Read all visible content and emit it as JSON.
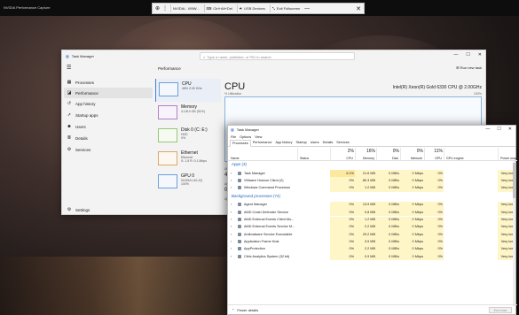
{
  "outer": {
    "title": "NVIDIA Performance Capture"
  },
  "toolbar": {
    "items": [
      "NVIDIA - VMW...",
      "Ctrl+Alt+Del",
      "USB Devices",
      "Exit Fullscreen"
    ]
  },
  "win1": {
    "title": "Task Manager",
    "search_placeholder": "Type a name, publisher, or PID to search",
    "nav": [
      {
        "label": "Processes",
        "icon": "grid-icon"
      },
      {
        "label": "Performance",
        "icon": "chart-icon",
        "active": true
      },
      {
        "label": "App history",
        "icon": "history-icon"
      },
      {
        "label": "Startup apps",
        "icon": "rocket-icon"
      },
      {
        "label": "Users",
        "icon": "users-icon"
      },
      {
        "label": "Details",
        "icon": "list-icon"
      },
      {
        "label": "Services",
        "icon": "services-icon"
      }
    ],
    "settings_label": "Settings",
    "panel_title": "Performance",
    "run_task": "Run new task",
    "resources": [
      {
        "name": "CPU",
        "sub1": "46% 2.00 GHz",
        "sub2": ""
      },
      {
        "name": "Memory",
        "sub1": "4.1/8.0 GB (51%)",
        "sub2": ""
      },
      {
        "name": "Disk 0 (C: E:)",
        "sub1": "HDD",
        "sub2": "0%"
      },
      {
        "name": "Ethernet",
        "sub1": "Ethernet",
        "sub2": "S: 1.5 R: 0.1 Mbps"
      },
      {
        "name": "GPU 0",
        "sub1": "NVIDIA L40-2Q",
        "sub2": "100%"
      }
    ],
    "cpu_title": "CPU",
    "cpu_model": "Intel(R) Xeon(R) Gold 6330 CPU @ 2.00GHz",
    "util_label": "% Utilization",
    "util_max": "100%",
    "stat_frags": [
      "Ut",
      "46",
      "Up",
      "0:0",
      "Up"
    ]
  },
  "win2": {
    "title": "Task Manager",
    "menu": [
      "File",
      "Options",
      "View"
    ],
    "tabs": [
      "Processes",
      "Performance",
      "App history",
      "Startup",
      "Users",
      "Details",
      "Services"
    ],
    "columns": [
      {
        "label": "Name",
        "pct": ""
      },
      {
        "label": "Status",
        "pct": ""
      },
      {
        "label": "CPU",
        "pct": "2%"
      },
      {
        "label": "Memory",
        "pct": "16%"
      },
      {
        "label": "Disk",
        "pct": "0%"
      },
      {
        "label": "Network",
        "pct": "0%"
      },
      {
        "label": "GPU",
        "pct": "11%"
      },
      {
        "label": "GPU engine",
        "pct": ""
      },
      {
        "label": "Power usage",
        "pct": ""
      }
    ],
    "apps_group": "Apps (3)",
    "apps": [
      {
        "name": "Task Manager",
        "cpu": "6.1%",
        "mem": "21.6 MB",
        "disk": "0 MB/s",
        "net": "0 Mbps",
        "gpu": "0%",
        "power": "Very low"
      },
      {
        "name": "VMware Horizon Client (2)",
        "cpu": "0%",
        "mem": "80.3 MB",
        "disk": "0 MB/s",
        "net": "0 Mbps",
        "gpu": "0%",
        "power": "Very low"
      },
      {
        "name": "Windows Command Processor",
        "cpu": "0%",
        "mem": "1.2 MB",
        "disk": "0 MB/s",
        "net": "0 Mbps",
        "gpu": "0%",
        "power": "Very low"
      }
    ],
    "bg_group": "Background processes (74)",
    "bg": [
      {
        "name": "Agent Manager",
        "cpu": "0%",
        "mem": "13.9 MB",
        "disk": "0 MB/s",
        "net": "0 Mbps",
        "gpu": "0%",
        "power": "Very low"
      },
      {
        "name": "AMD Crash Defender Service",
        "cpu": "0%",
        "mem": "0.8 MB",
        "disk": "0 MB/s",
        "net": "0 Mbps",
        "gpu": "0%",
        "power": "Very low"
      },
      {
        "name": "AMD External Events Client Mo...",
        "cpu": "0%",
        "mem": "1.2 MB",
        "disk": "0 MB/s",
        "net": "0 Mbps",
        "gpu": "0%",
        "power": "Very low"
      },
      {
        "name": "AMD External Events Service M...",
        "cpu": "0%",
        "mem": "2.2 MB",
        "disk": "0 MB/s",
        "net": "0 Mbps",
        "gpu": "0%",
        "power": "Very low"
      },
      {
        "name": "Antimalware Service Executable",
        "cpu": "0%",
        "mem": "29.2 MB",
        "disk": "0 MB/s",
        "net": "0 Mbps",
        "gpu": "0%",
        "power": "Very low"
      },
      {
        "name": "Application Frame Host",
        "cpu": "0%",
        "mem": "3.9 MB",
        "disk": "0 MB/s",
        "net": "0 Mbps",
        "gpu": "0%",
        "power": "Very low"
      },
      {
        "name": "AppProtection",
        "cpu": "0%",
        "mem": "2.2 MB",
        "disk": "0 MB/s",
        "net": "0 Mbps",
        "gpu": "0%",
        "power": "Very low"
      },
      {
        "name": "Citrix Analytics System (32 bit)",
        "cpu": "0%",
        "mem": "0.9 MB",
        "disk": "0 MB/s",
        "net": "0 Mbps",
        "gpu": "0%",
        "power": "Very low"
      }
    ],
    "fewer_details": "Fewer details",
    "end_task": "End task"
  }
}
